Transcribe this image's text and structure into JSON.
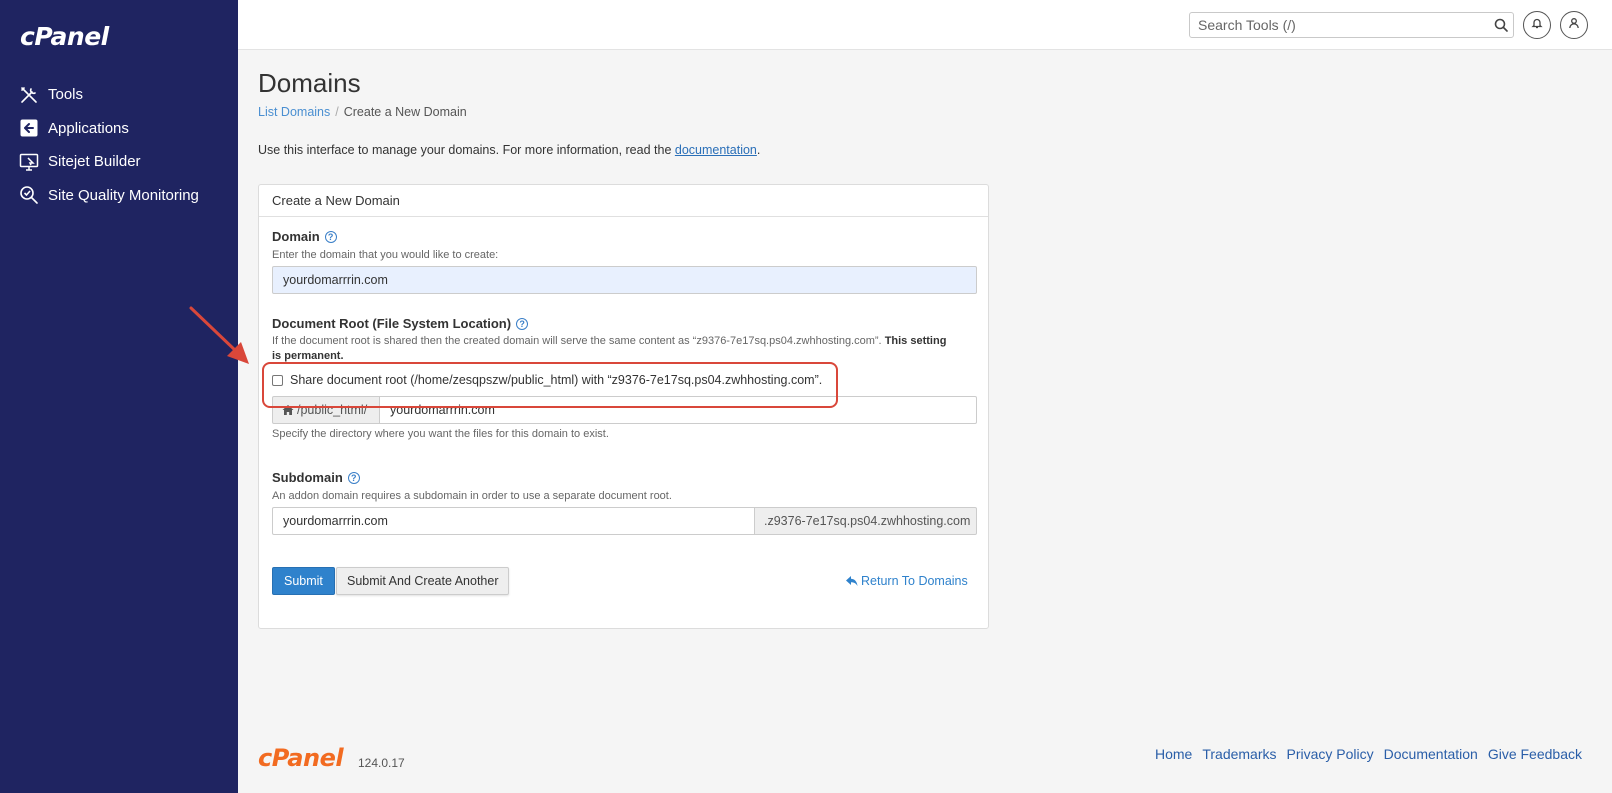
{
  "brand": "cPanel",
  "sidebar": {
    "items": [
      {
        "label": "Tools",
        "icon": "tools-icon"
      },
      {
        "label": "Applications",
        "icon": "applications-icon"
      },
      {
        "label": "Sitejet Builder",
        "icon": "sitejet-builder-icon"
      },
      {
        "label": "Site Quality Monitoring",
        "icon": "site-quality-monitoring-icon"
      }
    ]
  },
  "topbar": {
    "search_placeholder": "Search Tools (/)"
  },
  "page": {
    "title": "Domains",
    "breadcrumb": {
      "link": "List Domains",
      "separator": "/",
      "current": "Create a New Domain"
    },
    "intro_text": "Use this interface to manage your domains. For more information, read the ",
    "intro_link": "documentation",
    "intro_end": "."
  },
  "form": {
    "panel_title": "Create a New Domain",
    "domain": {
      "label": "Domain",
      "help": "Enter the domain that you would like to create:",
      "value": "yourdomarrrin.com"
    },
    "docroot": {
      "label": "Document Root (File System Location)",
      "help_line1": "If the document root is shared then the created domain will serve the same content as “z9376-7e17sq.ps04.zwhhosting.com”.",
      "help_bold1": "This setting",
      "help_bold2": "is permanent.",
      "checkbox_label": "Share document root (/home/zesqpszw/public_html) with “z9376-7e17sq.ps04.zwhhosting.com”.",
      "checkbox_checked": false,
      "prefix": "/public_html/",
      "value": "yourdomarrrin.com",
      "hint": "Specify the directory where you want the files for this domain to exist."
    },
    "subdomain": {
      "label": "Subdomain",
      "help": "An addon domain requires a subdomain in order to use a separate document root.",
      "value": "yourdomarrrin.com",
      "suffix": ".z9376-7e17sq.ps04.zwhhosting.com"
    },
    "submit_label": "Submit",
    "submit_another_label": "Submit And Create Another",
    "return_label": "Return To Domains"
  },
  "footer": {
    "logo": "cPanel",
    "version": "124.0.17",
    "links": [
      "Home",
      "Trademarks",
      "Privacy Policy",
      "Documentation",
      "Give Feedback"
    ]
  },
  "colors": {
    "sidebar_bg": "#1f2461",
    "primary": "#2f82cc",
    "annotation_red": "#d9473a",
    "cpanel_orange": "#f26b21"
  }
}
